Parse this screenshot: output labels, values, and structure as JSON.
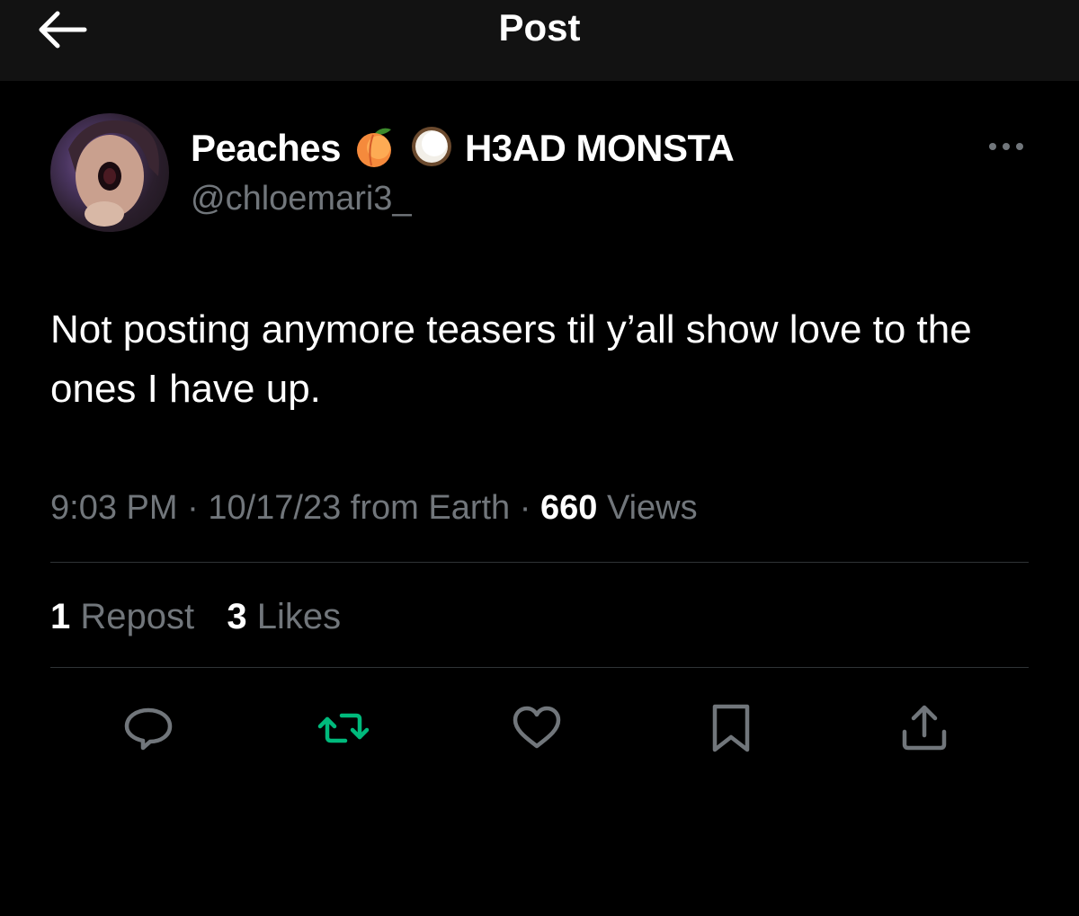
{
  "header": {
    "title": "Post",
    "back_icon": "arrow-left-icon"
  },
  "post": {
    "display_name": "Peaches",
    "name_emojis": [
      "peach-emoji",
      "coconut-emoji"
    ],
    "name_suffix": "H3AD MONSTA",
    "handle": "@chloemari3_",
    "text": "Not posting anymore teasers til y’all show love to the ones I have up.",
    "time": "9:03 PM",
    "date": "10/17/23",
    "source": "from Earth",
    "views_count": "660",
    "views_label": "Views",
    "separator": "·",
    "reposts_count": "1",
    "reposts_label": "Repost",
    "likes_count": "3",
    "likes_label": "Likes"
  },
  "actions": [
    {
      "name": "reply",
      "icon": "speech-bubble-icon"
    },
    {
      "name": "repost",
      "icon": "repost-arrows-icon",
      "color": "#00ba7c"
    },
    {
      "name": "like",
      "icon": "heart-icon"
    },
    {
      "name": "bookmark",
      "icon": "bookmark-icon"
    },
    {
      "name": "share",
      "icon": "share-upload-icon"
    }
  ],
  "colors": {
    "background": "#000000",
    "header_background": "#121212",
    "primary_text": "#ffffff",
    "secondary_text": "#71767b",
    "divider": "#2f3336",
    "repost_accent": "#00ba7c"
  }
}
